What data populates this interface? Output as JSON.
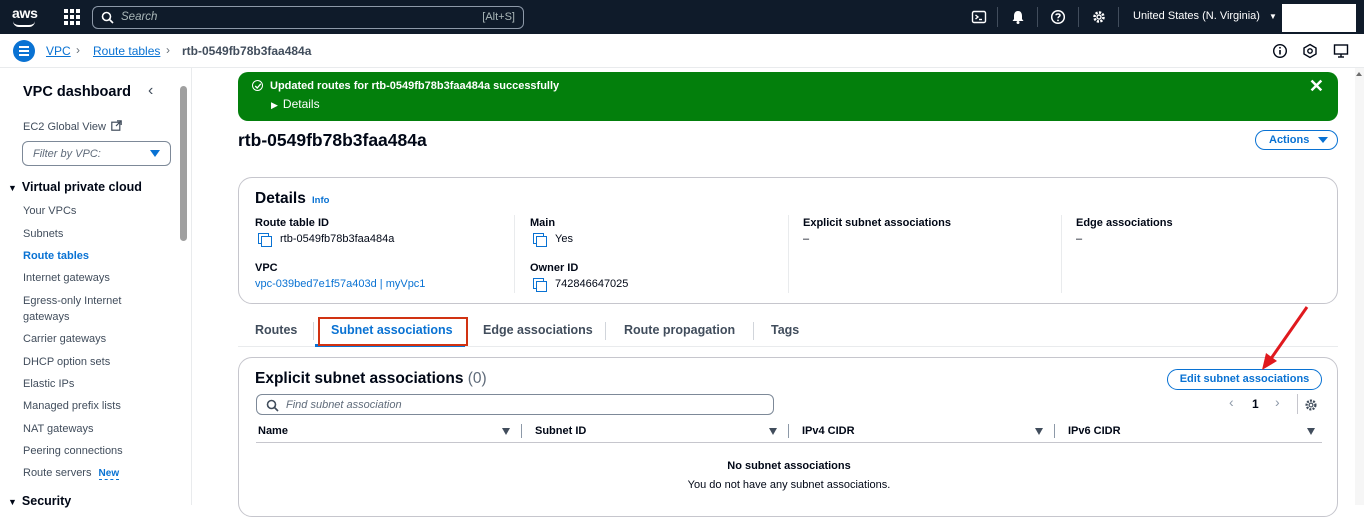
{
  "topbar": {
    "logo": "aws",
    "search_placeholder": "Search",
    "search_shortcut": "[Alt+S]",
    "region": "United States (N. Virginia)",
    "icons": [
      "apps-grid-icon",
      "cloudshell-icon",
      "bell-icon",
      "help-icon",
      "gear-icon"
    ]
  },
  "breadcrumb": {
    "items": [
      "VPC",
      "Route tables"
    ],
    "current": "rtb-0549fb78b3faa484a"
  },
  "sidebar": {
    "title": "VPC dashboard",
    "ec2_global_view": "EC2 Global View",
    "filter_placeholder": "Filter by VPC:",
    "section": "Virtual private cloud",
    "items": [
      "Your VPCs",
      "Subnets",
      "Route tables",
      "Internet gateways",
      "Egress-only Internet gateways",
      "Carrier gateways",
      "DHCP option sets",
      "Elastic IPs",
      "Managed prefix lists",
      "NAT gateways",
      "Peering connections",
      "Route servers"
    ],
    "active_item": "Route tables",
    "new_badge": "New",
    "next_section": "Security"
  },
  "flash": {
    "message": "Updated routes for rtb-0549fb78b3faa484a successfully",
    "details": "Details",
    "color": "#037f0c"
  },
  "page": {
    "title": "rtb-0549fb78b3faa484a",
    "actions_label": "Actions"
  },
  "details": {
    "header": "Details",
    "info": "Info",
    "route_table_id_label": "Route table ID",
    "route_table_id": "rtb-0549fb78b3faa484a",
    "vpc_label": "VPC",
    "vpc_value": "vpc-039bed7e1f57a403d | myVpc1",
    "main_label": "Main",
    "main_value": "Yes",
    "owner_label": "Owner ID",
    "owner_value": "742846647025",
    "explicit_label": "Explicit subnet associations",
    "explicit_value": "–",
    "edge_label": "Edge associations",
    "edge_value": "–"
  },
  "tabs": {
    "items": [
      "Routes",
      "Subnet associations",
      "Edge associations",
      "Route propagation",
      "Tags"
    ],
    "active": "Subnet associations"
  },
  "assoc": {
    "title": "Explicit subnet associations",
    "count": "(0)",
    "edit_button": "Edit subnet associations",
    "search_placeholder": "Find subnet association",
    "page": "1",
    "columns": [
      "Name",
      "Subnet ID",
      "IPv4 CIDR",
      "IPv6 CIDR"
    ],
    "empty_title": "No subnet associations",
    "empty_sub": "You do not have any subnet associations."
  }
}
